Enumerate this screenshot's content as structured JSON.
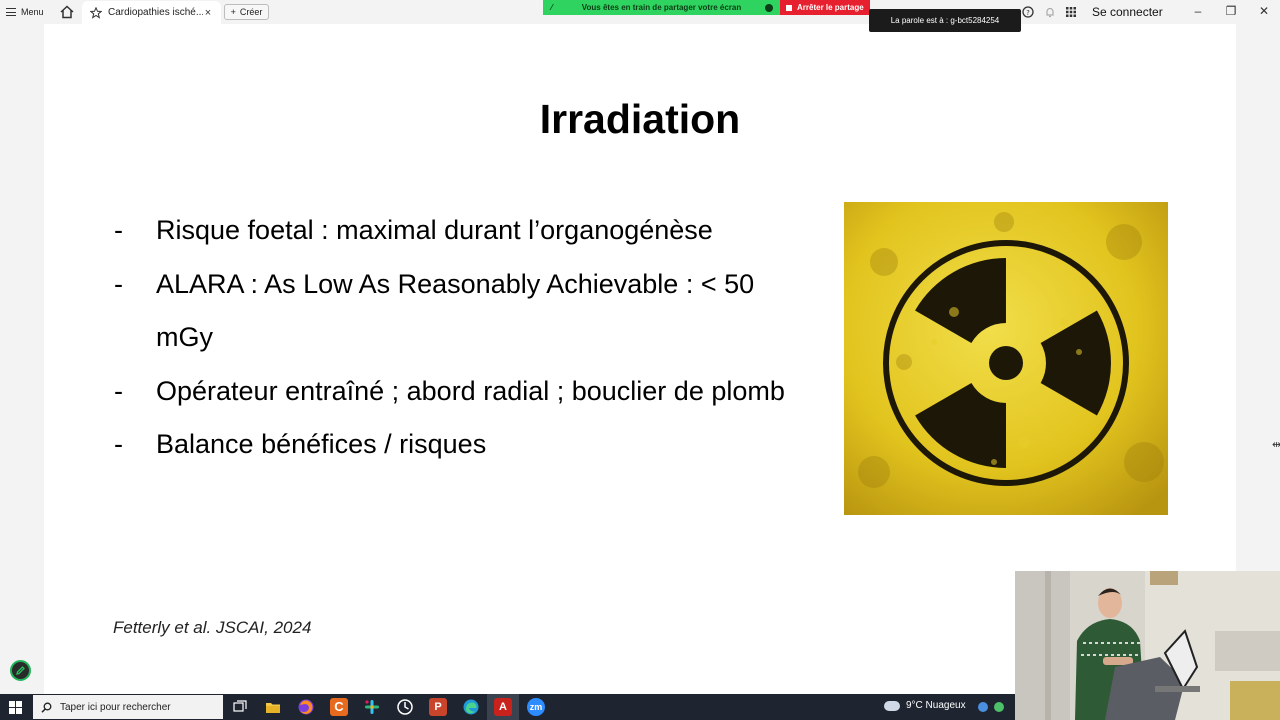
{
  "browser": {
    "menu_label": "Menu",
    "tab_title": "Cardiopathies isché...",
    "tab_close": "×",
    "new_label": "Créer",
    "connect_label": "Se connecter"
  },
  "share": {
    "sharing_text": "Vous êtes en train de partager votre écran",
    "stop_label": "Arrêter le partage",
    "speaker_text": "La parole est à : g-bct5284254"
  },
  "slide": {
    "title": "Irradiation",
    "bullets": [
      {
        "dash": "-",
        "text": "Risque foetal : maximal durant l’organogénèse"
      },
      {
        "dash": "-",
        "text": "ALARA : As Low As Reasonably Achievable : < 50 mGy"
      },
      {
        "dash": "-",
        "text": "Opérateur entraîné ; abord radial ; bouclier de plomb"
      },
      {
        "dash": "-",
        "text": "Balance bénéfices / risques"
      }
    ],
    "citation": "Fetterly et al. JSCAI, 2024",
    "image_icon": "radiation-symbol"
  },
  "taskbar": {
    "search_placeholder": "Taper ici pour rechercher",
    "weather_text": "9°C Nuageux"
  },
  "colors": {
    "share_green": "#2fd35f",
    "stop_red": "#e6202e",
    "radiation_yellow": "#e3c61c",
    "taskbar": "#1e2530"
  }
}
